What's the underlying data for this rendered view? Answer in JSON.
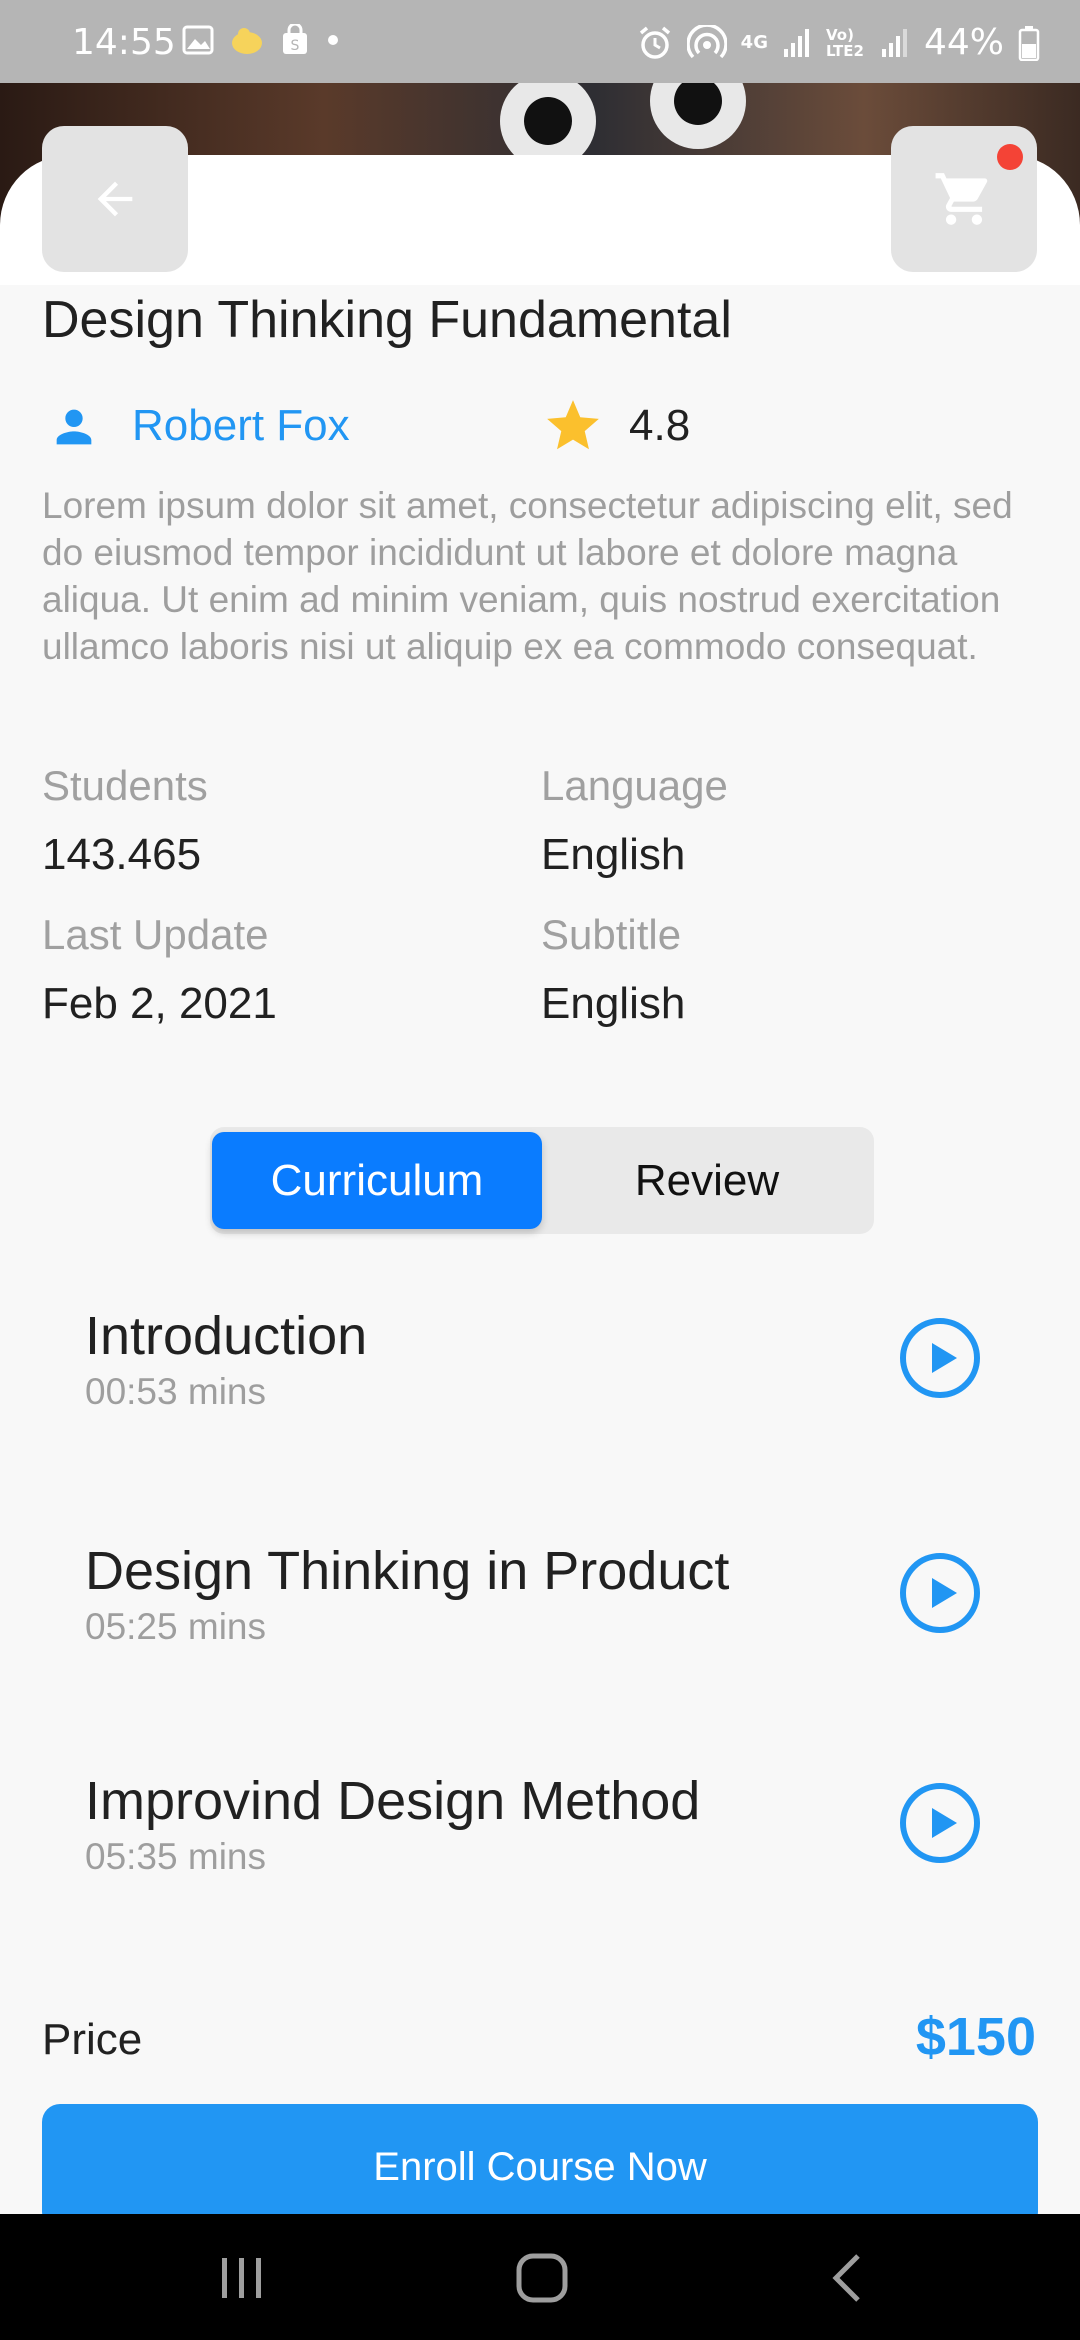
{
  "status_bar": {
    "time": "14:55",
    "network": "4G",
    "carrier": "Vo) LTE2",
    "battery": "44%"
  },
  "header": {
    "back_icon": "arrow-left-icon",
    "cart_icon": "cart-icon"
  },
  "course": {
    "title": "Design Thinking Fundamental",
    "author": "Robert Fox",
    "rating": "4.8",
    "description": "Lorem ipsum dolor sit amet, consectetur adipiscing elit, sed do eiusmod tempor incididunt ut labore et dolore magna aliqua. Ut enim ad minim veniam, quis nostrud exercitation ullamco laboris nisi ut aliquip ex ea commodo consequat."
  },
  "meta": {
    "students_label": "Students",
    "students_value": "143.465",
    "language_label": "Language",
    "language_value": "English",
    "last_update_label": "Last Update",
    "last_update_value": "Feb 2, 2021",
    "subtitle_label": "Subtitle",
    "subtitle_value": "English"
  },
  "tabs": [
    {
      "label": "Curriculum",
      "active": true
    },
    {
      "label": "Review",
      "active": false
    }
  ],
  "lessons": [
    {
      "title": "Introduction",
      "duration": "00:53 mins"
    },
    {
      "title": "Design Thinking in Product",
      "duration": "05:25 mins"
    },
    {
      "title": "Improvind Design Method",
      "duration": "05:35 mins"
    }
  ],
  "footer": {
    "price_label": "Price",
    "price_value": "$150",
    "enroll_label": "Enroll Course Now"
  },
  "colors": {
    "accent": "#2196f3",
    "tab_active": "#0a7cff",
    "star": "#fbc02d",
    "notification_dot": "#f44336"
  }
}
